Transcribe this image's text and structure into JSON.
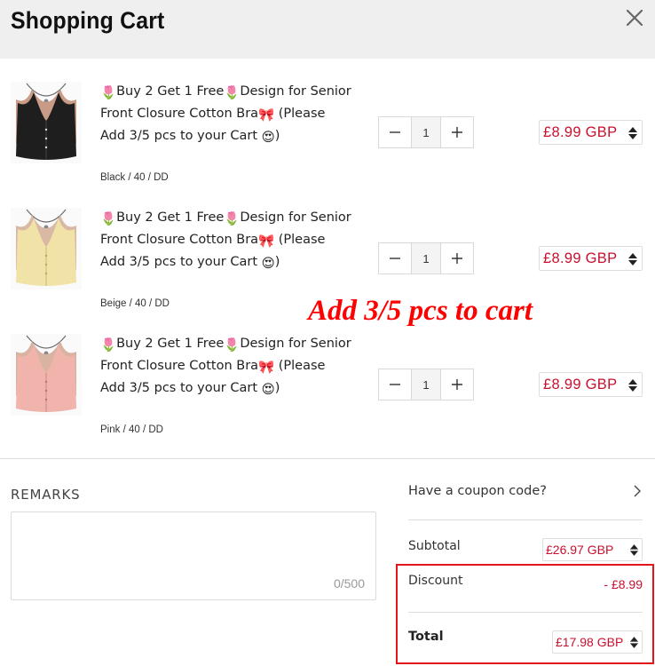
{
  "header": {
    "title": "Shopping Cart",
    "close_icon": "close-icon"
  },
  "items": [
    {
      "title": "Buy 2 Get 1 Free Design for Senior Front Closure Cotton Bra (Please Add 3/5 pcs to your Cart )",
      "title_parts": {
        "p1": "Buy 2 Get 1 Free",
        "p2": "Design for Senior Front Closure Cotton Bra",
        "p3": "(Please Add 3/5 pcs to your Cart",
        "p4": ")"
      },
      "variant": "Black / 40 / DD",
      "color": "#1e1e1e",
      "quantity": "1",
      "price": "£8.99 GBP"
    },
    {
      "title": "Buy 2 Get 1 Free Design for Senior Front Closure Cotton Bra (Please Add 3/5 pcs to your Cart )",
      "title_parts": {
        "p1": "Buy 2 Get 1 Free",
        "p2": "Design for Senior Front Closure Cotton Bra",
        "p3": "(Please Add 3/5 pcs to your Cart",
        "p4": ")"
      },
      "variant": "Beige / 40 / DD",
      "color": "#f1e3a8",
      "quantity": "1",
      "price": "£8.99 GBP"
    },
    {
      "title": "Buy 2 Get 1 Free Design for Senior Front Closure Cotton Bra (Please Add 3/5 pcs to your Cart )",
      "title_parts": {
        "p1": "Buy 2 Get 1 Free",
        "p2": "Design for Senior Front Closure Cotton Bra",
        "p3": "(Please Add 3/5 pcs to your Cart",
        "p4": ")"
      },
      "variant": "Pink / 40 / DD",
      "color": "#f0b4ac",
      "quantity": "1",
      "price": "£8.99 GBP"
    }
  ],
  "overlay": {
    "text": "Add 3/5 pcs to cart"
  },
  "remarks": {
    "label": "REMARKS",
    "counter": "0/500",
    "value": ""
  },
  "summary": {
    "coupon_label": "Have a coupon code?",
    "subtotal_label": "Subtotal",
    "subtotal_value": "£26.97 GBP",
    "discount_label": "Discount",
    "discount_value": "- £8.99",
    "total_label": "Total",
    "total_value": "£17.98 GBP"
  },
  "colors": {
    "price": "#c8102e",
    "highlight": "#e4141b",
    "header_bg": "#efefef"
  }
}
